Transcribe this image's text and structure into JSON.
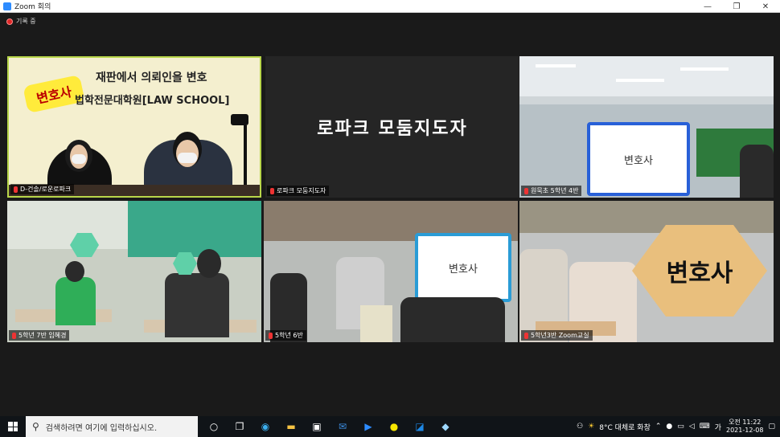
{
  "window": {
    "title": "Zoom 회의",
    "controls": [
      "—",
      "❐",
      "✕"
    ]
  },
  "recording": {
    "label": "기록 중"
  },
  "tiles": [
    {
      "name": "D-건솔/로운로파크",
      "mic": "muted",
      "slide_badge": "변호사",
      "slide_line1": "재판에서 의뢰인을 변호",
      "slide_line2": "법학전문대학원[LAW SCHOOL]"
    },
    {
      "name": "로파크 모둠지도자",
      "mic": "muted",
      "display_name": "로파크 모둠지도자"
    },
    {
      "name": "원묵초 5학년 4반",
      "mic": "muted",
      "board_text": "변호사"
    },
    {
      "name": "5학년 7반 임혜경",
      "mic": "muted"
    },
    {
      "name": "5학년 6반",
      "mic": "muted",
      "board_text": "변호사"
    },
    {
      "name": "5학년3반 Zoom교실",
      "mic": "muted",
      "card_text": "변호사"
    }
  ],
  "taskbar": {
    "search_placeholder": "검색하려면 여기에 입력하십시오.",
    "weather": "8°C 대체로 화창",
    "time": "오전 11:22",
    "date": "2021-12-08",
    "ime": "가"
  },
  "colors": {
    "active_border": "#b8d64a",
    "zoom_blue": "#2d8cff"
  }
}
